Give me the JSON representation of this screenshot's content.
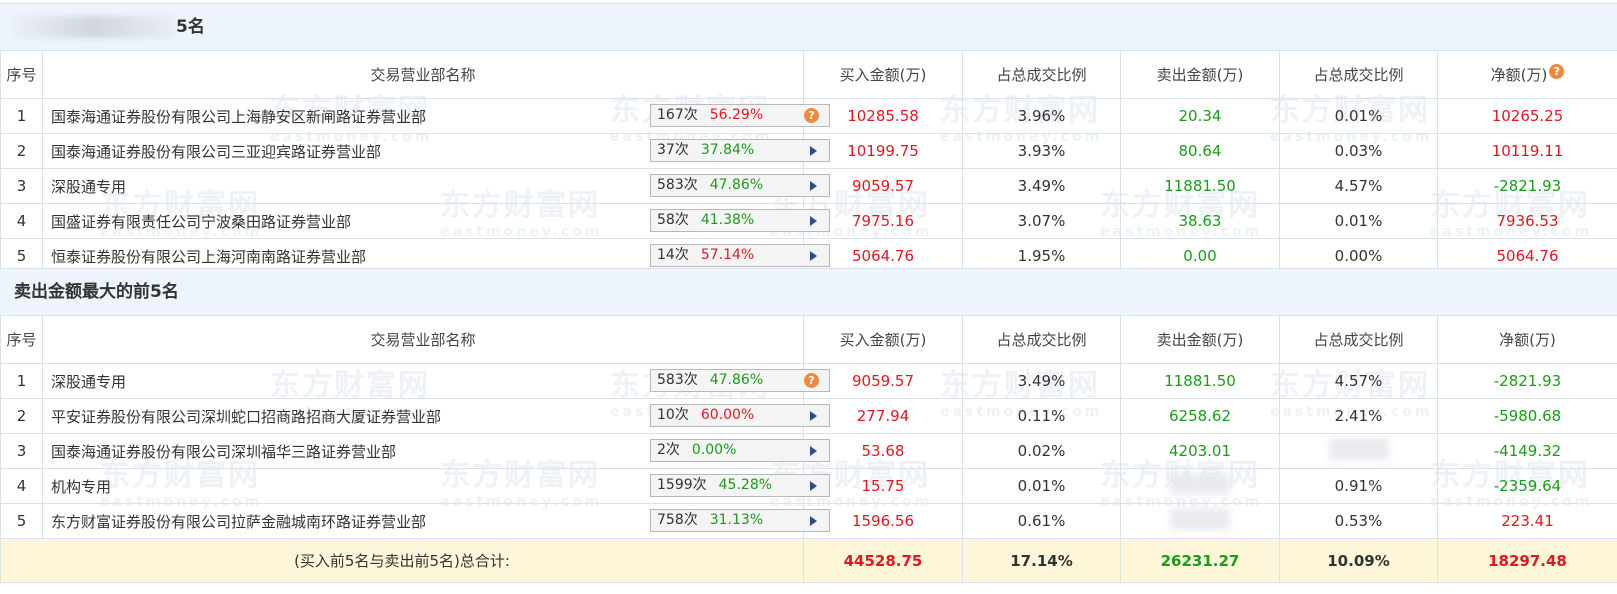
{
  "buy_section": {
    "title_suffix": "5名",
    "headers": [
      "序号",
      "交易营业部名称",
      "买入金额(万)",
      "占总成交比例",
      "卖出金额(万)",
      "占总成交比例",
      "净额(万)"
    ],
    "rows": [
      {
        "no": "1",
        "name": "国泰海通证券股份有限公司上海静安区新闸路证券营业部",
        "count": "167次",
        "pct": "56.29%",
        "pct_color": "red",
        "icon": "help",
        "buy": "10285.58",
        "buy_ratio": "3.96%",
        "sell": "20.34",
        "sell_ratio": "0.01%",
        "net": "10265.25",
        "net_color": "red"
      },
      {
        "no": "2",
        "name": "国泰海通证券股份有限公司三亚迎宾路证券营业部",
        "count": "37次",
        "pct": "37.84%",
        "pct_color": "green",
        "icon": "arrow",
        "buy": "10199.75",
        "buy_ratio": "3.93%",
        "sell": "80.64",
        "sell_ratio": "0.03%",
        "net": "10119.11",
        "net_color": "red"
      },
      {
        "no": "3",
        "name": "深股通专用",
        "count": "583次",
        "pct": "47.86%",
        "pct_color": "green",
        "icon": "arrow",
        "buy": "9059.57",
        "buy_ratio": "3.49%",
        "sell": "11881.50",
        "sell_ratio": "4.57%",
        "net": "-2821.93",
        "net_color": "green"
      },
      {
        "no": "4",
        "name": "国盛证券有限责任公司宁波桑田路证券营业部",
        "count": "58次",
        "pct": "41.38%",
        "pct_color": "green",
        "icon": "arrow",
        "buy": "7975.16",
        "buy_ratio": "3.07%",
        "sell": "38.63",
        "sell_ratio": "0.01%",
        "net": "7936.53",
        "net_color": "red"
      },
      {
        "no": "5",
        "name": "恒泰证券股份有限公司上海河南南路证券营业部",
        "count": "14次",
        "pct": "57.14%",
        "pct_color": "red",
        "icon": "arrow",
        "buy": "5064.76",
        "buy_ratio": "1.95%",
        "sell": "0.00",
        "sell_ratio": "0.00%",
        "net": "5064.76",
        "net_color": "red"
      }
    ]
  },
  "sell_section": {
    "title": "卖出金额最大的前5名",
    "headers": [
      "序号",
      "交易营业部名称",
      "买入金额(万)",
      "占总成交比例",
      "卖出金额(万)",
      "占总成交比例",
      "净额(万)"
    ],
    "rows": [
      {
        "no": "1",
        "name": "深股通专用",
        "count": "583次",
        "pct": "47.86%",
        "pct_color": "green",
        "icon": "help",
        "buy": "9059.57",
        "buy_ratio": "3.49%",
        "sell": "11881.50",
        "sell_ratio": "4.57%",
        "net": "-2821.93",
        "net_color": "green"
      },
      {
        "no": "2",
        "name": "平安证券股份有限公司深圳蛇口招商路招商大厦证券营业部",
        "count": "10次",
        "pct": "60.00%",
        "pct_color": "red",
        "icon": "arrow",
        "buy": "277.94",
        "buy_ratio": "0.11%",
        "sell": "6258.62",
        "sell_ratio": "2.41%",
        "net": "-5980.68",
        "net_color": "green"
      },
      {
        "no": "3",
        "name": "国泰海通证券股份有限公司深圳福华三路证券营业部",
        "count": "2次",
        "pct": "0.00%",
        "pct_color": "green",
        "icon": "arrow",
        "buy": "53.68",
        "buy_ratio": "0.02%",
        "sell": "4203.01",
        "sell_ratio": "",
        "net": "-4149.32",
        "net_color": "green"
      },
      {
        "no": "4",
        "name": "机构专用",
        "count": "1599次",
        "pct": "45.28%",
        "pct_color": "green",
        "icon": "arrow",
        "buy": "15.75",
        "buy_ratio": "0.01%",
        "sell": "",
        "sell_ratio": "0.91%",
        "net": "-2359.64",
        "net_color": "green"
      },
      {
        "no": "5",
        "name": "东方财富证券股份有限公司拉萨金融城南环路证券营业部",
        "count": "758次",
        "pct": "31.13%",
        "pct_color": "green",
        "icon": "arrow",
        "buy": "1596.56",
        "buy_ratio": "0.61%",
        "sell": "",
        "sell_ratio": "0.53%",
        "net": "223.41",
        "net_color": "red"
      }
    ],
    "total": {
      "label": "(买入前5名与卖出前5名)总合计:",
      "buy": "44528.75",
      "buy_ratio": "17.14%",
      "sell": "26231.27",
      "sell_ratio": "10.09%",
      "net": "18297.48"
    }
  },
  "watermark": {
    "cn": "东方财富网",
    "en": "eastmoney.com"
  },
  "colors": {
    "red": "#e0181f",
    "green": "#1a9c1a",
    "header_bg": "#eef4fb",
    "total_bg": "#fdf6d8",
    "border": "#d7e2ef",
    "help_icon": "#f08a3a",
    "arrow_icon": "#2a4f8f"
  }
}
